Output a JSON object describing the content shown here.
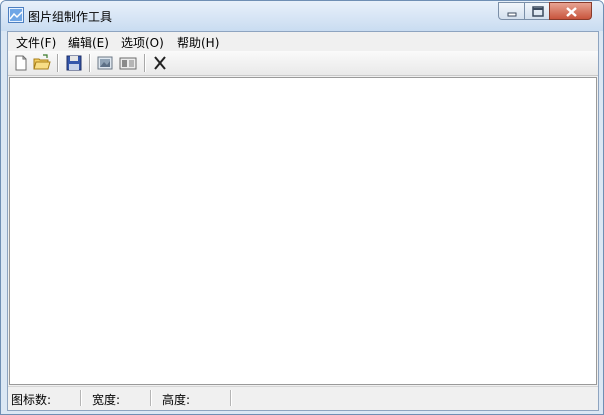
{
  "window": {
    "title": "图片组制作工具",
    "controls": {
      "minimize": "minimize-icon",
      "maximize": "maximize-icon",
      "close": "close-icon"
    }
  },
  "menu": {
    "file": "文件(F)",
    "edit": "编辑(E)",
    "options": "选项(O)",
    "help": "帮助(H)"
  },
  "toolbar": {
    "buttons": [
      "new-file-icon",
      "open-folder-icon",
      "save-icon",
      "import-image-icon",
      "export-image-icon",
      "delete-icon"
    ]
  },
  "status": {
    "icon_count": "图标数:",
    "width": "宽度:",
    "height": "高度:"
  },
  "colors": {
    "title_gradient_top": "#e8f0fa",
    "title_gradient_bottom": "#c9dcf1",
    "close_button": "#c8553d"
  }
}
